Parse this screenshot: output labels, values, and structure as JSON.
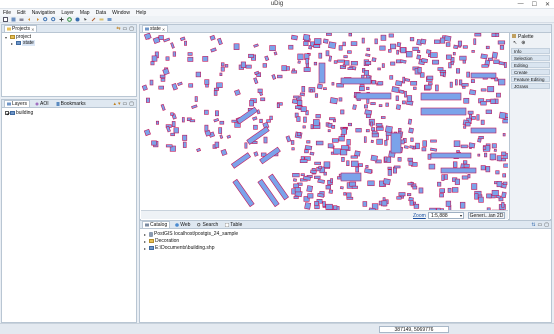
{
  "window": {
    "title": "uDig",
    "min_glyph": "—",
    "max_glyph": "☐",
    "close_glyph": "✕"
  },
  "menu": {
    "items": [
      "File",
      "Edit",
      "Navigation",
      "Layer",
      "Map",
      "Data",
      "Window",
      "Help"
    ]
  },
  "projects_panel": {
    "tab_label": "Projects",
    "tab_close": "✕",
    "tree": [
      {
        "label": "project",
        "expanded": true
      },
      {
        "label": "state",
        "expanded": false
      }
    ]
  },
  "layers_panel": {
    "tabs": [
      {
        "label": "Layers",
        "active": true
      },
      {
        "label": "AOI",
        "active": false
      },
      {
        "label": "Bookmarks",
        "active": false
      }
    ],
    "layers": [
      {
        "label": "building",
        "checked": true
      }
    ]
  },
  "map_editor": {
    "tab_label": "state",
    "tab_close": "✕",
    "zoom_label": "Zoom",
    "scale_value": "1:5,888",
    "crs_button": "Generi...ian 2D",
    "colors": {
      "fill": "#7ba3ea",
      "outline": "#c2185b",
      "background": "#ffffff"
    }
  },
  "palette": {
    "title": "Palette",
    "categories": [
      "Info",
      "Selection",
      "Editing",
      "Create",
      "Feature Editing",
      "JGrass"
    ]
  },
  "catalog_panel": {
    "tabs": [
      {
        "label": "Catalog",
        "active": true
      },
      {
        "label": "Web",
        "active": false
      },
      {
        "label": "Search",
        "active": false
      },
      {
        "label": "Table",
        "active": false
      }
    ],
    "items": [
      {
        "label": "PostGIS localhost/postgis_24_sample",
        "icon": "database-icon"
      },
      {
        "label": "Decoration",
        "icon": "folder-icon"
      },
      {
        "label": "E:\\Documents\\building.shp",
        "icon": "shapefile-icon"
      }
    ]
  },
  "status": {
    "coordinates": "387149, 5069776"
  }
}
